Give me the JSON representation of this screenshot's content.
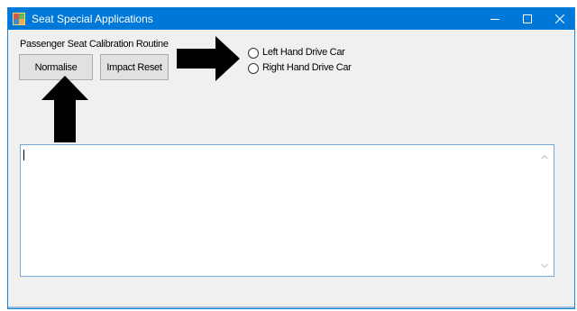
{
  "window": {
    "title": "Seat Special Applications",
    "icon": "app-window-icon",
    "controls": [
      "minimize-icon",
      "maximize-icon",
      "close-icon"
    ]
  },
  "form": {
    "heading": "Passenger Seat Calibration Routine",
    "buttons": {
      "normalise": "Normalise",
      "impact_reset": "Impact Reset"
    },
    "radios": [
      {
        "label": "Left Hand Drive Car",
        "checked": false
      },
      {
        "label": "Right Hand Drive Car",
        "checked": false
      }
    ],
    "output_text": ""
  },
  "colors": {
    "titlebar": "#0078d7",
    "window_bg": "#f0f0f0",
    "button_bg": "#e1e1e1",
    "arrow": "#000000"
  }
}
